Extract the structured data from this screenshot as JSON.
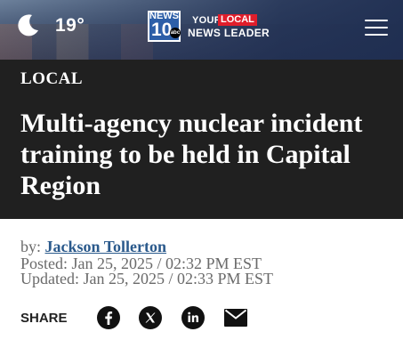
{
  "header": {
    "weather": {
      "icon": "moon-icon",
      "temperature": "19°"
    },
    "logo": {
      "top_text": "NEWS",
      "number": "10",
      "network": "abc",
      "tagline_prefix": "YOUR",
      "tagline_highlight": "LOCAL",
      "tagline_suffix": "NEWS LEADER",
      "highlight_color": "#e01e2b",
      "box_color": "#2d5fa8"
    },
    "menu_icon": "hamburger-menu-icon"
  },
  "article": {
    "category": "LOCAL",
    "headline": "Multi-agency nuclear incident training to be held in Capital Region",
    "byline_prefix": "by:",
    "author": "Jackson Tollerton",
    "posted": "Posted: Jan 25, 2025 / 02:32 PM EST",
    "updated": "Updated: Jan 25, 2025 / 02:33 PM EST"
  },
  "share": {
    "label": "SHARE",
    "buttons": [
      {
        "icon": "facebook-icon"
      },
      {
        "icon": "x-icon"
      },
      {
        "icon": "linkedin-icon"
      },
      {
        "icon": "email-icon"
      }
    ]
  },
  "colors": {
    "hero_background": "#202020",
    "author_link": "#2b5a8c",
    "meta_text": "#6a6a6a"
  }
}
